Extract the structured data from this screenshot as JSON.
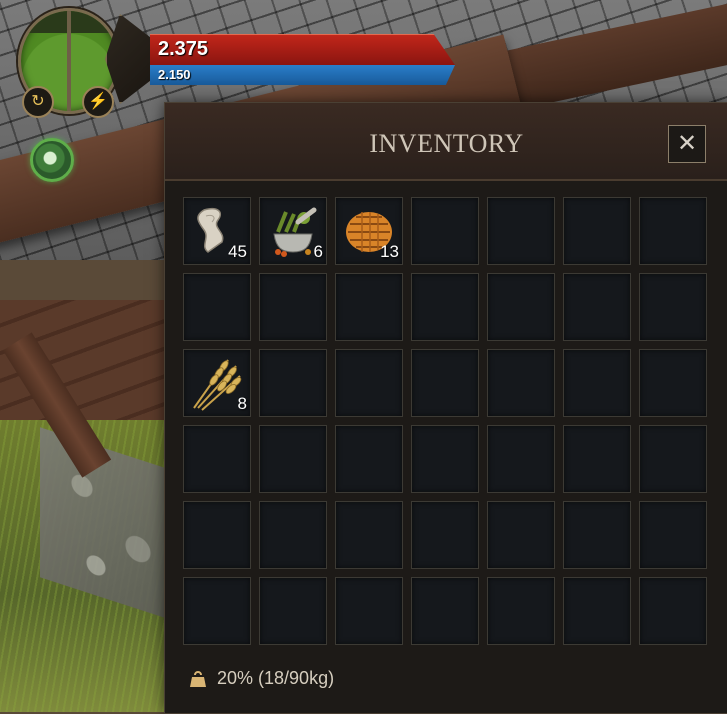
{
  "hud": {
    "health_value": "2.375",
    "mana_value": "2.150",
    "icons": [
      "swap-icon",
      "lightning-icon",
      "buff-icon"
    ],
    "colors": {
      "health": "#c1261a",
      "mana": "#2a7ec9"
    }
  },
  "inventory": {
    "title": "INVENTORY",
    "close_label": "✕",
    "weight_text": "20% (18/90kg)",
    "columns": 7,
    "rows": 6,
    "slots": [
      {
        "item": "cloth",
        "qty": "45"
      },
      {
        "item": "herb-mortar",
        "qty": "6"
      },
      {
        "item": "orange-hide",
        "qty": "13"
      },
      null,
      null,
      null,
      null,
      null,
      null,
      null,
      null,
      null,
      null,
      null,
      {
        "item": "wheat",
        "qty": "8"
      },
      null,
      null,
      null,
      null,
      null,
      null,
      null,
      null,
      null,
      null,
      null,
      null,
      null,
      null,
      null,
      null,
      null,
      null,
      null,
      null,
      null,
      null,
      null,
      null,
      null,
      null,
      null
    ]
  }
}
